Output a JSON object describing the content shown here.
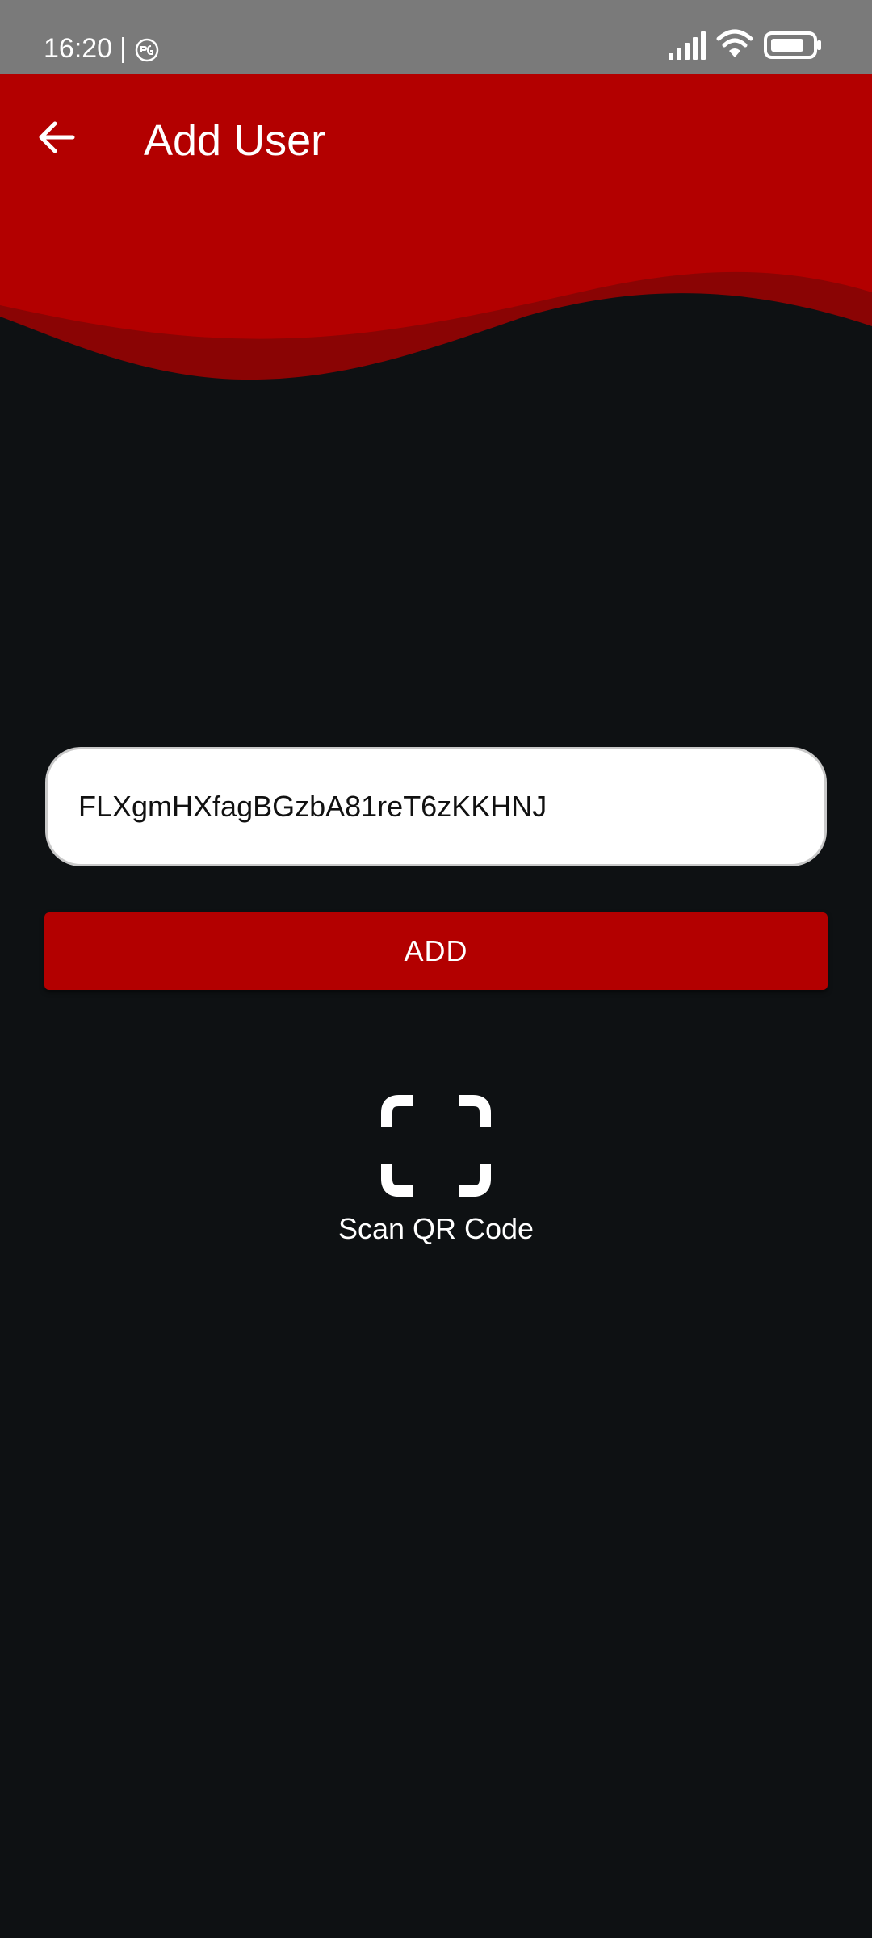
{
  "status_bar": {
    "time": "16:20",
    "separator": "|",
    "icons": [
      "pgp-icon",
      "signal-icon",
      "wifi-icon",
      "battery-icon"
    ]
  },
  "header": {
    "title": "Add User",
    "back_icon": "arrow-left-icon"
  },
  "form": {
    "user_id_value": "FLXgmHXfagBGzbA81reT6zKKHNJ",
    "add_label": "ADD"
  },
  "scan": {
    "label": "Scan QR Code",
    "icon": "scan-frame-icon"
  },
  "colors": {
    "accent": "#b30000",
    "accent_dark": "#8a0404",
    "background": "#0e1113",
    "status_bar": "#7a7a7a"
  }
}
